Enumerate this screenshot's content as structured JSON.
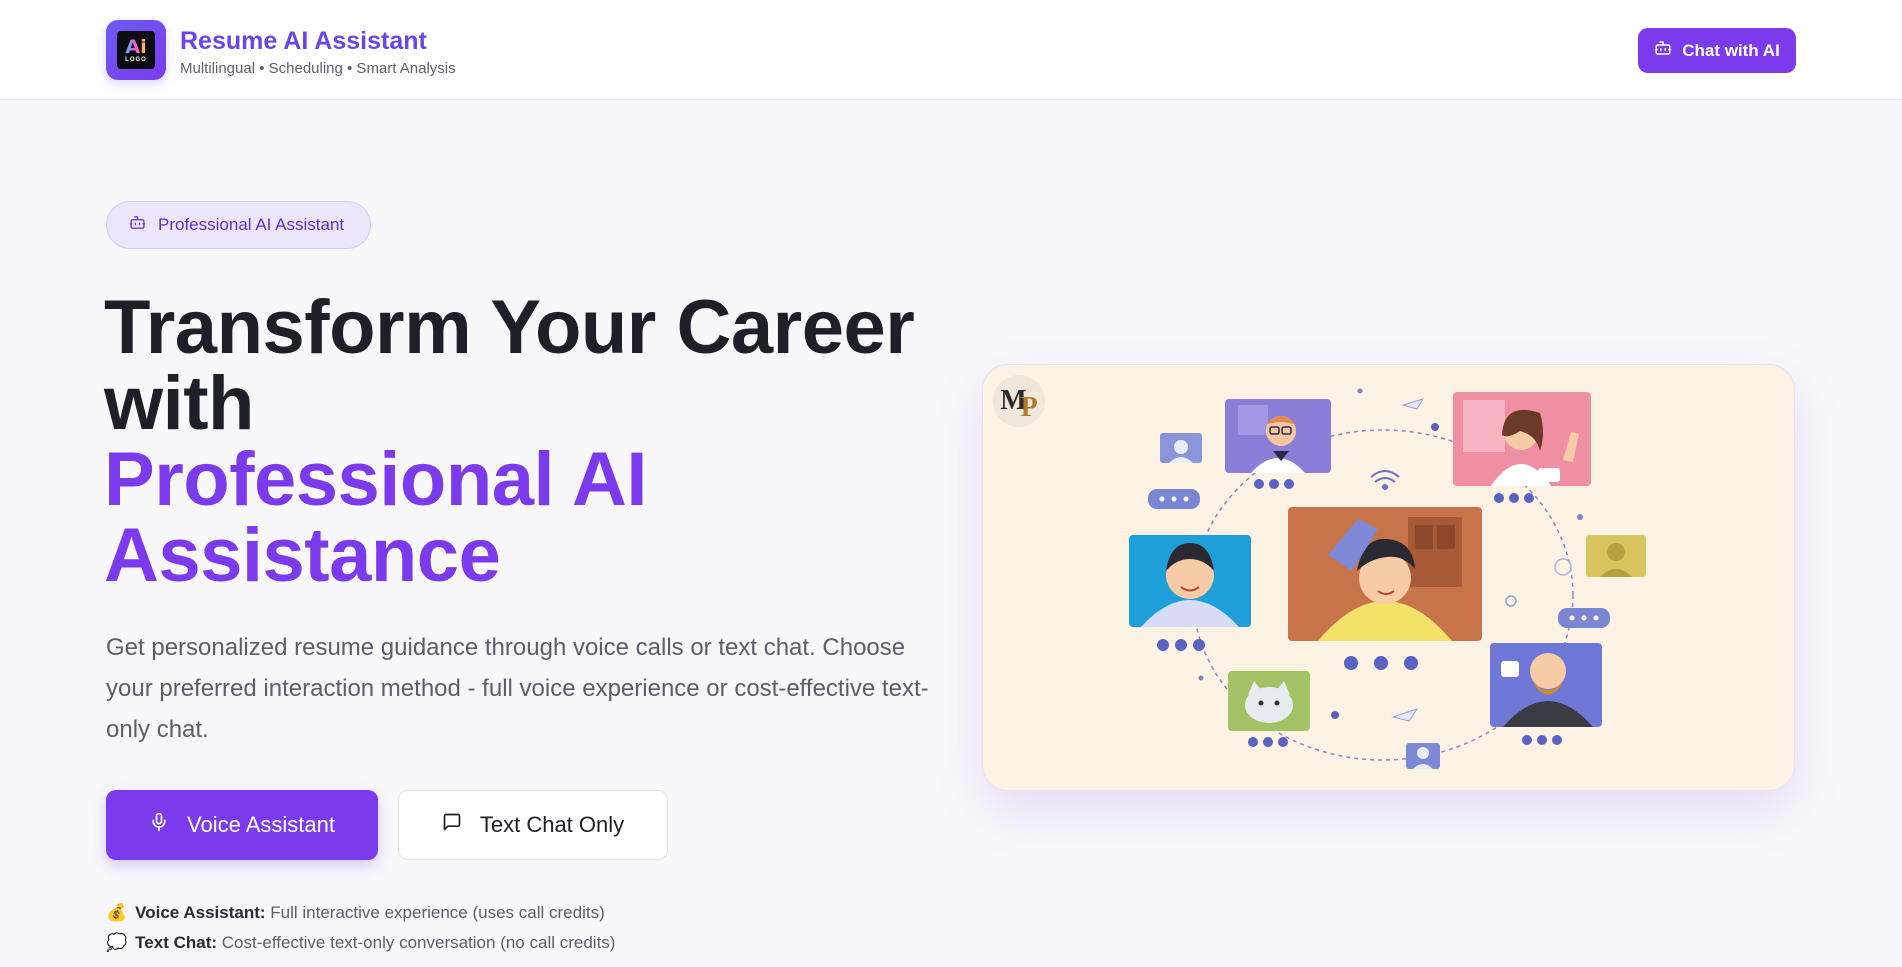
{
  "header": {
    "logo_text": "Ai",
    "logo_subtext": "LOGO",
    "title": "Resume AI Assistant",
    "subtitle": "Multilingual • Scheduling • Smart Analysis",
    "chat_button_label": "Chat with AI",
    "chat_button_icon": "bot-icon"
  },
  "hero": {
    "badge_label": "Professional AI Assistant",
    "badge_icon": "bot-icon",
    "headline_line1": "Transform Your Career",
    "headline_line2": "with",
    "headline_accent_line1": "Professional AI",
    "headline_accent_line2": "Assistance",
    "description": "Get personalized resume guidance through voice calls or text chat. Choose your preferred interaction method - full voice experience or cost-effective text-only chat.",
    "voice_button_label": "Voice Assistant",
    "voice_button_icon": "microphone-icon",
    "text_button_label": "Text Chat Only",
    "text_button_icon": "message-square-icon",
    "notes": [
      {
        "emoji": "💰",
        "title": "Voice Assistant:",
        "text": "Full interactive experience (uses call credits)"
      },
      {
        "emoji": "💭",
        "title": "Text Chat:",
        "text": "Cost-effective text-only conversation (no call credits)"
      }
    ]
  },
  "illustration": {
    "logo_m": "M",
    "logo_p": "P"
  },
  "colors": {
    "accent": "#7c3aed",
    "title": "#6a45e8",
    "illustration_bg": "#fdf3e4",
    "badge_bg": "#ece6fb"
  }
}
